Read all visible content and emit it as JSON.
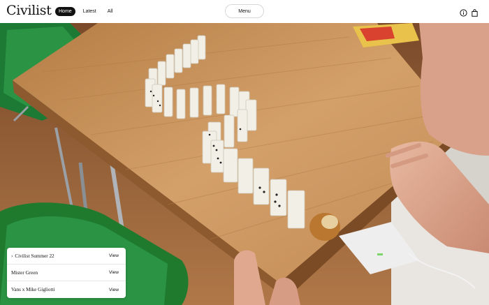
{
  "site": {
    "logo": "Civilist"
  },
  "nav": {
    "items": [
      {
        "label": "Home",
        "active": true
      },
      {
        "label": "Latest",
        "active": false
      },
      {
        "label": "All",
        "active": false
      }
    ]
  },
  "header": {
    "menu_label": "Menu",
    "icons": {
      "info": "info-icon",
      "bag": "shopping-bag-icon"
    }
  },
  "hero": {
    "description_icon": "photo-dominoes-on-table"
  },
  "collections": {
    "rows": [
      {
        "title": "Civilist Summer 22",
        "action": "View",
        "arrow": "›"
      },
      {
        "title": "Mister Green",
        "action": "View"
      },
      {
        "title": "Vans x Mike Gigliotti",
        "action": "View"
      }
    ]
  },
  "colors": {
    "header_bg": "#ffffff",
    "active_pill": "#111111",
    "table_wood": "#c9955f",
    "chair_green": "#1f7a2e"
  }
}
